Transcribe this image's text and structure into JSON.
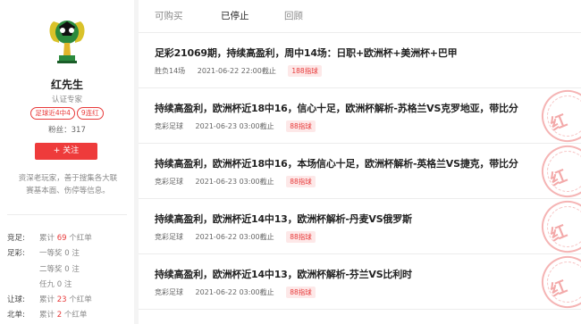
{
  "user": {
    "name": "红先生",
    "role": "认证专家",
    "tags": [
      "足球近4中4",
      "9连红"
    ],
    "fans_label": "粉丝：",
    "fans_count": "317",
    "follow_label": "+ 关注",
    "bio": "资深老玩家，善于搜集各大联赛基本面、伤停等信息。"
  },
  "stats": [
    {
      "label": "竞足:",
      "prefix": "累计",
      "num": "69",
      "suffix": "个红单"
    },
    {
      "label": "足彩:",
      "prefix": "一等奖",
      "num": "0",
      "suffix": "注"
    },
    {
      "label": "",
      "prefix": "二等奖",
      "num": "0",
      "suffix": "注"
    },
    {
      "label": "",
      "prefix": "任九",
      "num": "0",
      "suffix": "注"
    },
    {
      "label": "让球:",
      "prefix": "累计",
      "num": "23",
      "suffix": "个红单"
    },
    {
      "label": "北单:",
      "prefix": "累计",
      "num": "2",
      "suffix": "个红单"
    }
  ],
  "tabs": [
    "可购买",
    "已停止",
    "回顾"
  ],
  "active_tab": "已停止",
  "items": [
    {
      "title": "足彩21069期，持续高盈利，周中14场：日职+欧洲杯+美洲杯+巴甲",
      "league": "胜负14场",
      "date": "2021-06-22 22:00截止",
      "price": "188指球",
      "stamp": false
    },
    {
      "title": "持续高盈利，欧洲杯近18中16，信心十足，欧洲杯解析-苏格兰VS克罗地亚，带比分",
      "league": "竞彩足球",
      "date": "2021-06-23 03:00截止",
      "price": "88指球",
      "stamp": true
    },
    {
      "title": "持续高盈利，欧洲杯近18中16，本场信心十足，欧洲杯解析-英格兰VS捷克，带比分",
      "league": "竞彩足球",
      "date": "2021-06-23 03:00截止",
      "price": "88指球",
      "stamp": true
    },
    {
      "title": "持续高盈利，欧洲杯近14中13，欧洲杯解析-丹麦VS俄罗斯",
      "league": "竞彩足球",
      "date": "2021-06-22 03:00截止",
      "price": "88指球",
      "stamp": true
    },
    {
      "title": "持续高盈利，欧洲杯近14中13，欧洲杯解析-芬兰VS比利时",
      "league": "竞彩足球",
      "date": "2021-06-22 03:00截止",
      "price": "88指球",
      "stamp": true
    }
  ],
  "stamp_text": "红",
  "colors": {
    "accent": "#ee3b3b",
    "stamp": "#f3a9a9"
  }
}
